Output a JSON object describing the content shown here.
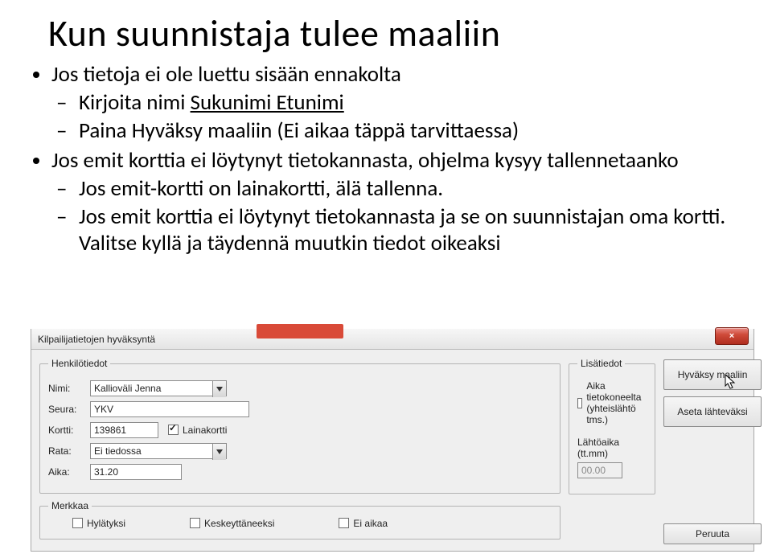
{
  "slide": {
    "title": "Kun suunnistaja tulee maaliin",
    "bullets": {
      "b1": "Jos tietoja ei ole luettu sisään ennakolta",
      "b1s1_plain": "Kirjoita nimi ",
      "b1s1_u": "Sukunimi Etunimi",
      "b1s2": "Paina Hyväksy maaliin (Ei aikaa täppä tarvittaessa)",
      "b2": "Jos emit korttia ei löytynyt tietokannasta, ohjelma kysyy tallennetaanko",
      "b2s1": "Jos emit-kortti on lainakortti, älä tallenna.",
      "b2s2": "Jos emit korttia ei löytynyt tietokannasta ja se on suunnistajan oma kortti. Valitse kyllä ja täydennä muutkin tiedot oikeaksi"
    }
  },
  "dialog": {
    "title": "Kilpailijatietojen hyväksyntä",
    "groups": {
      "henkilo": "Henkilötiedot",
      "lisa": "Lisätiedot",
      "merkkaa": "Merkkaa"
    },
    "labels": {
      "nimi": "Nimi:",
      "seura": "Seura:",
      "kortti": "Kortti:",
      "lainakortti": "Lainakortti",
      "rata": "Rata:",
      "aika": "Aika:",
      "aika_tieto": "Aika tietokoneelta (yhteislähtö tms.)",
      "lahtoaika": "Lähtöaika (tt.mm)",
      "hylatyksi": "Hylätyksi",
      "keskeyt": "Keskeyttäneeksi",
      "eiaikaa": "Ei aikaa"
    },
    "values": {
      "nimi": "Kallioväli Jenna",
      "seura": "YKV",
      "kortti": "139861",
      "rata": "Ei tiedossa",
      "aika": "31.20",
      "lahtoaika": "00.00"
    },
    "buttons": {
      "hyvaksy": "Hyväksy maaliin",
      "aseta": "Aseta lähteväksi",
      "peruuta": "Peruuta"
    },
    "close_icon": "×"
  }
}
